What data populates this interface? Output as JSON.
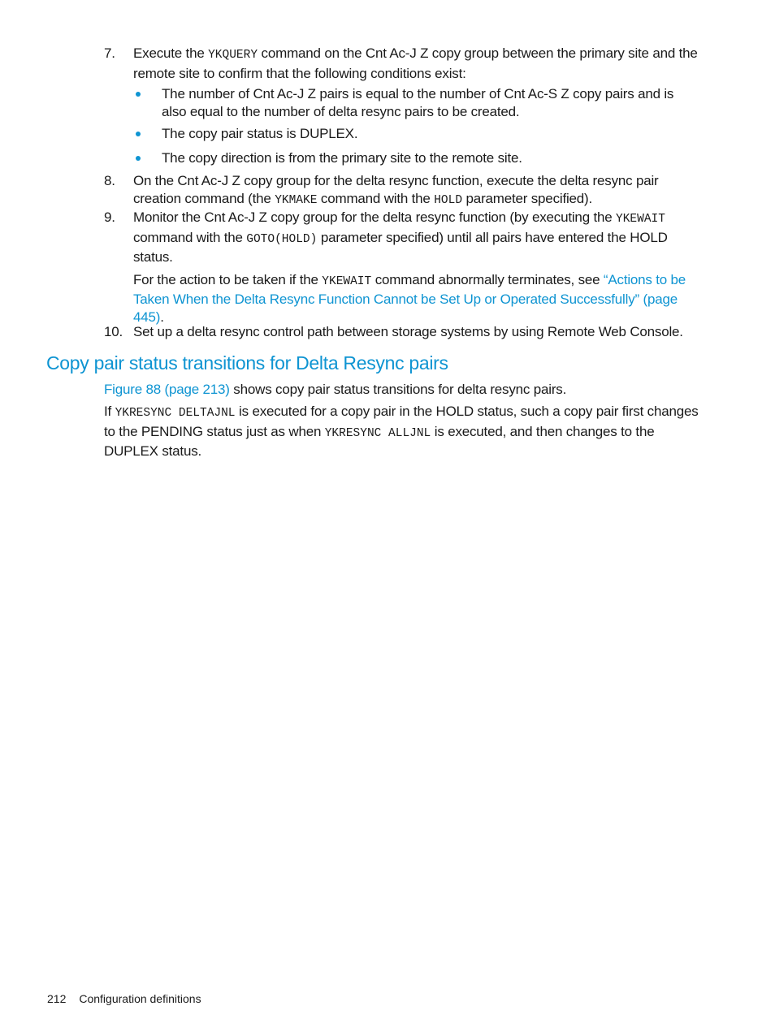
{
  "steps": {
    "s7": {
      "num": "7.",
      "t1": "Execute the ",
      "cmd": "YKQUERY",
      "t2": " command on the Cnt Ac-J Z copy group between the primary site and the remote site to confirm that the following conditions exist:",
      "bullets": [
        "The number of Cnt Ac-J Z pairs is equal to the number of Cnt Ac-S Z copy pairs and is also equal to the number of delta resync pairs to be created.",
        "The copy pair status is DUPLEX.",
        "The copy direction is from the primary site to the remote site."
      ]
    },
    "s8": {
      "num": "8.",
      "t1": "On the Cnt Ac-J Z copy group for the delta resync function, execute the delta resync pair creation command (the ",
      "cmd1": "YKMAKE",
      "t2": " command with the ",
      "cmd2": "HOLD",
      "t3": " parameter specified)."
    },
    "s9": {
      "num": "9.",
      "t1": "Monitor the Cnt Ac-J Z copy group for the delta resync function (by executing the ",
      "cmd1": "YKEWAIT",
      "t2": " command with the ",
      "cmd2": "GOTO(HOLD)",
      "t3": "  parameter specified) until all pairs have entered the HOLD status.",
      "note_t1": "For the action to be taken if the ",
      "note_cmd": "YKEWAIT",
      "note_t2": " command abnormally terminates, see ",
      "note_link": "“Actions to be Taken When the Delta Resync Function Cannot be Set Up or Operated Successfully” (page 445)",
      "note_t3": "."
    },
    "s10": {
      "num": "10.",
      "text": "Set up a delta resync control path between storage systems by using Remote Web Console."
    }
  },
  "section": {
    "heading": "Copy pair status transitions for Delta Resync pairs",
    "p1_link": "Figure 88 (page 213)",
    "p1_text": " shows copy pair status transitions for delta resync pairs.",
    "p2_t1": "If ",
    "p2_cmd1": "YKRESYNC DELTAJNL",
    "p2_t2": " is executed for a copy pair in the HOLD status, such a copy pair first changes to the PENDING status just as when ",
    "p2_cmd2": "YKRESYNC ALLJNL",
    "p2_t3": " is executed, and then changes to the DUPLEX status."
  },
  "footer": {
    "page_number": "212",
    "chapter": "Configuration definitions"
  },
  "colors": {
    "accent": "#0e94d2",
    "text": "#1a1a1a"
  }
}
